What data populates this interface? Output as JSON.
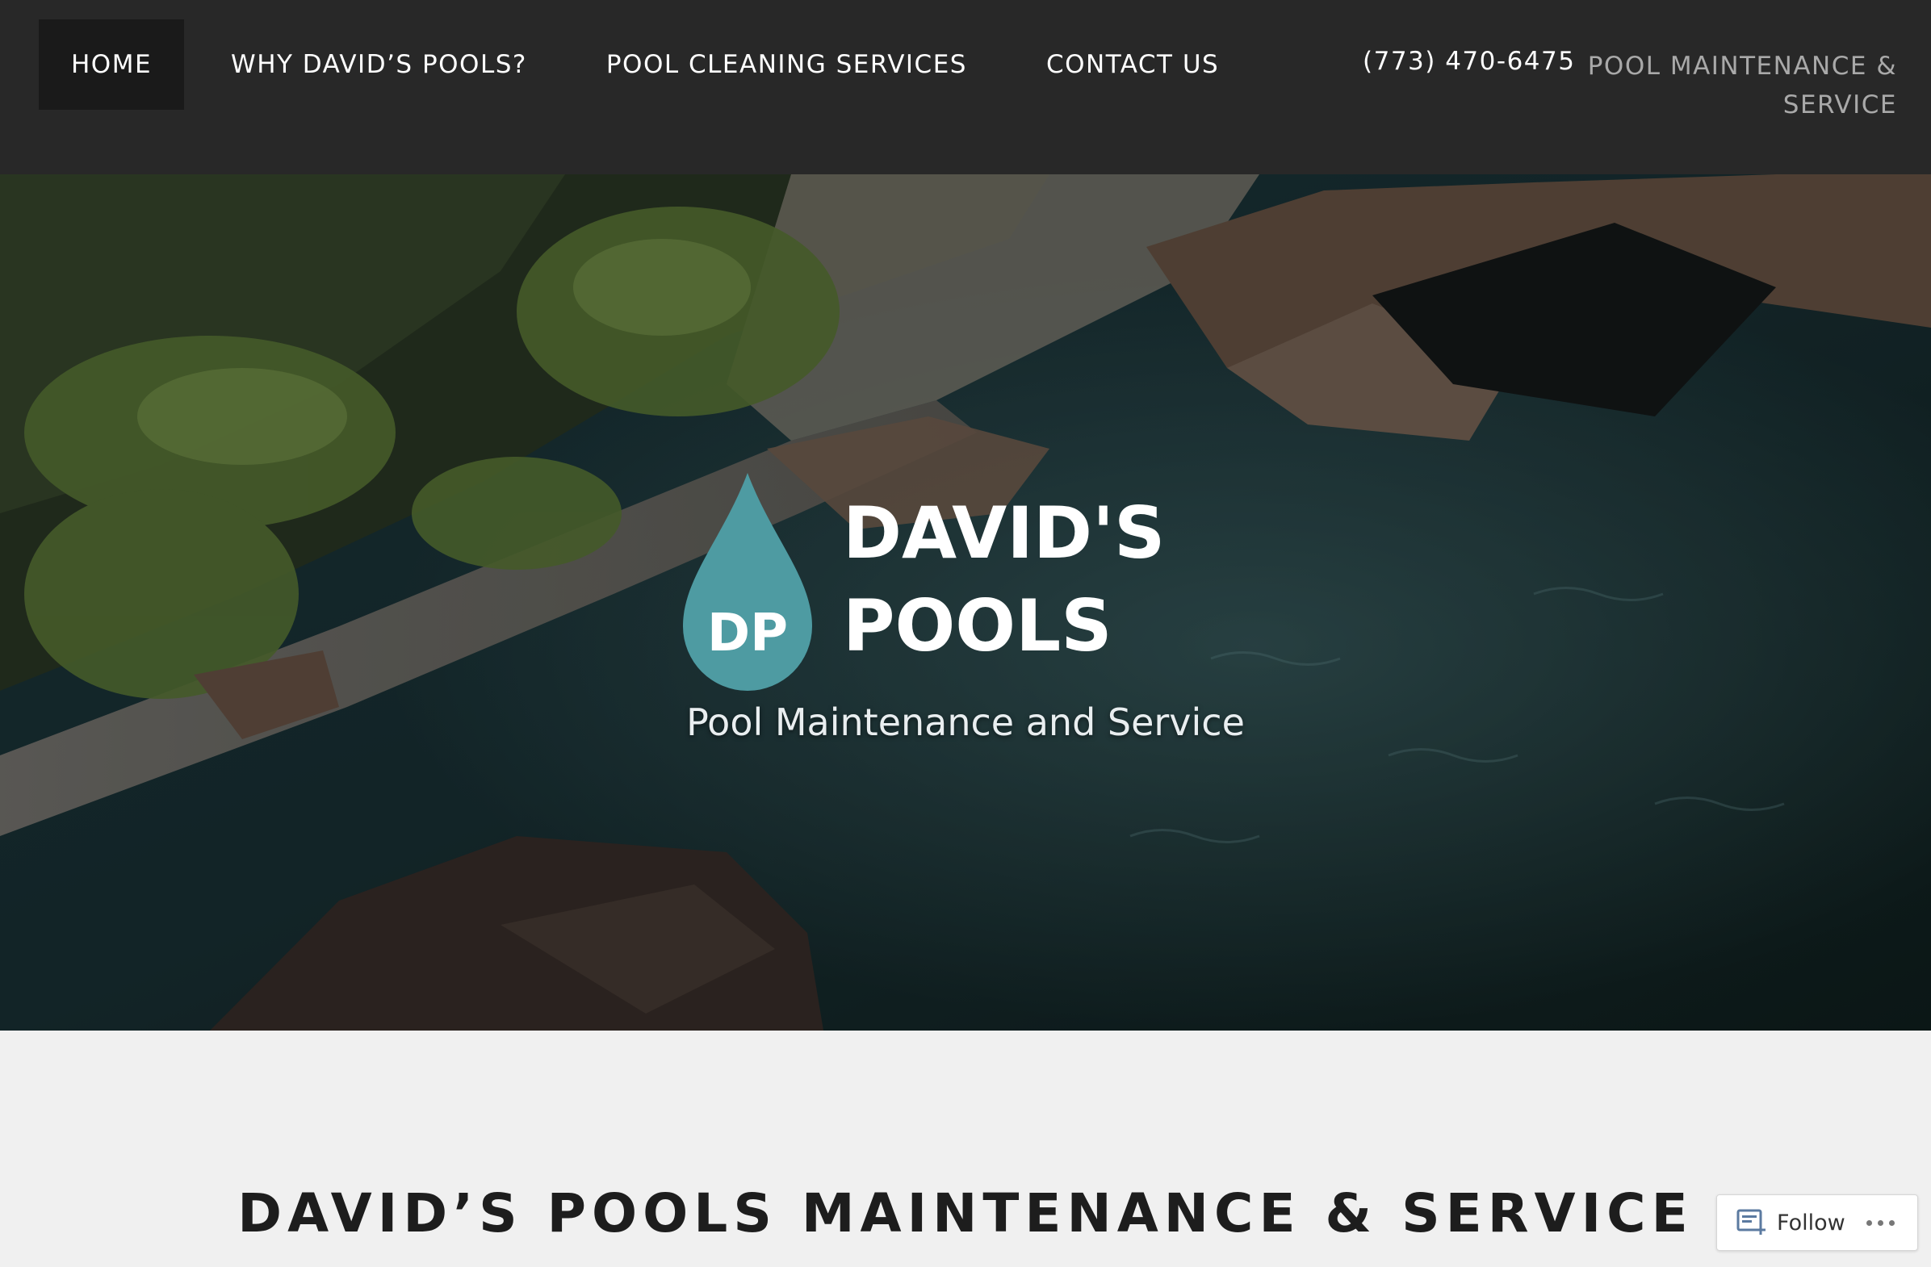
{
  "nav": {
    "items": [
      {
        "label": "HOME",
        "active": true
      },
      {
        "label": "WHY DAVID’S POOLS?",
        "active": false
      },
      {
        "label": "POOL CLEANING SERVICES",
        "active": false
      },
      {
        "label": "CONTACT US",
        "active": false
      }
    ],
    "phone": "(773) 470-6475",
    "tagline": "POOL MAINTENANCE & SERVICE"
  },
  "hero": {
    "logo_monogram": "DP",
    "logo_line1": "DAVID'S",
    "logo_line2": "POOLS",
    "tagline": "Pool Maintenance and Service"
  },
  "content": {
    "title": "DAVID’S POOLS MAINTENANCE & SERVICE"
  },
  "follow_widget": {
    "label": "Follow",
    "icon": "follow-icon"
  },
  "colors": {
    "nav_bg": "#282828",
    "nav_active_bg": "#1a1a1a",
    "logo_drop": "#4e9ba2",
    "page_bg": "#f0f0f0"
  }
}
